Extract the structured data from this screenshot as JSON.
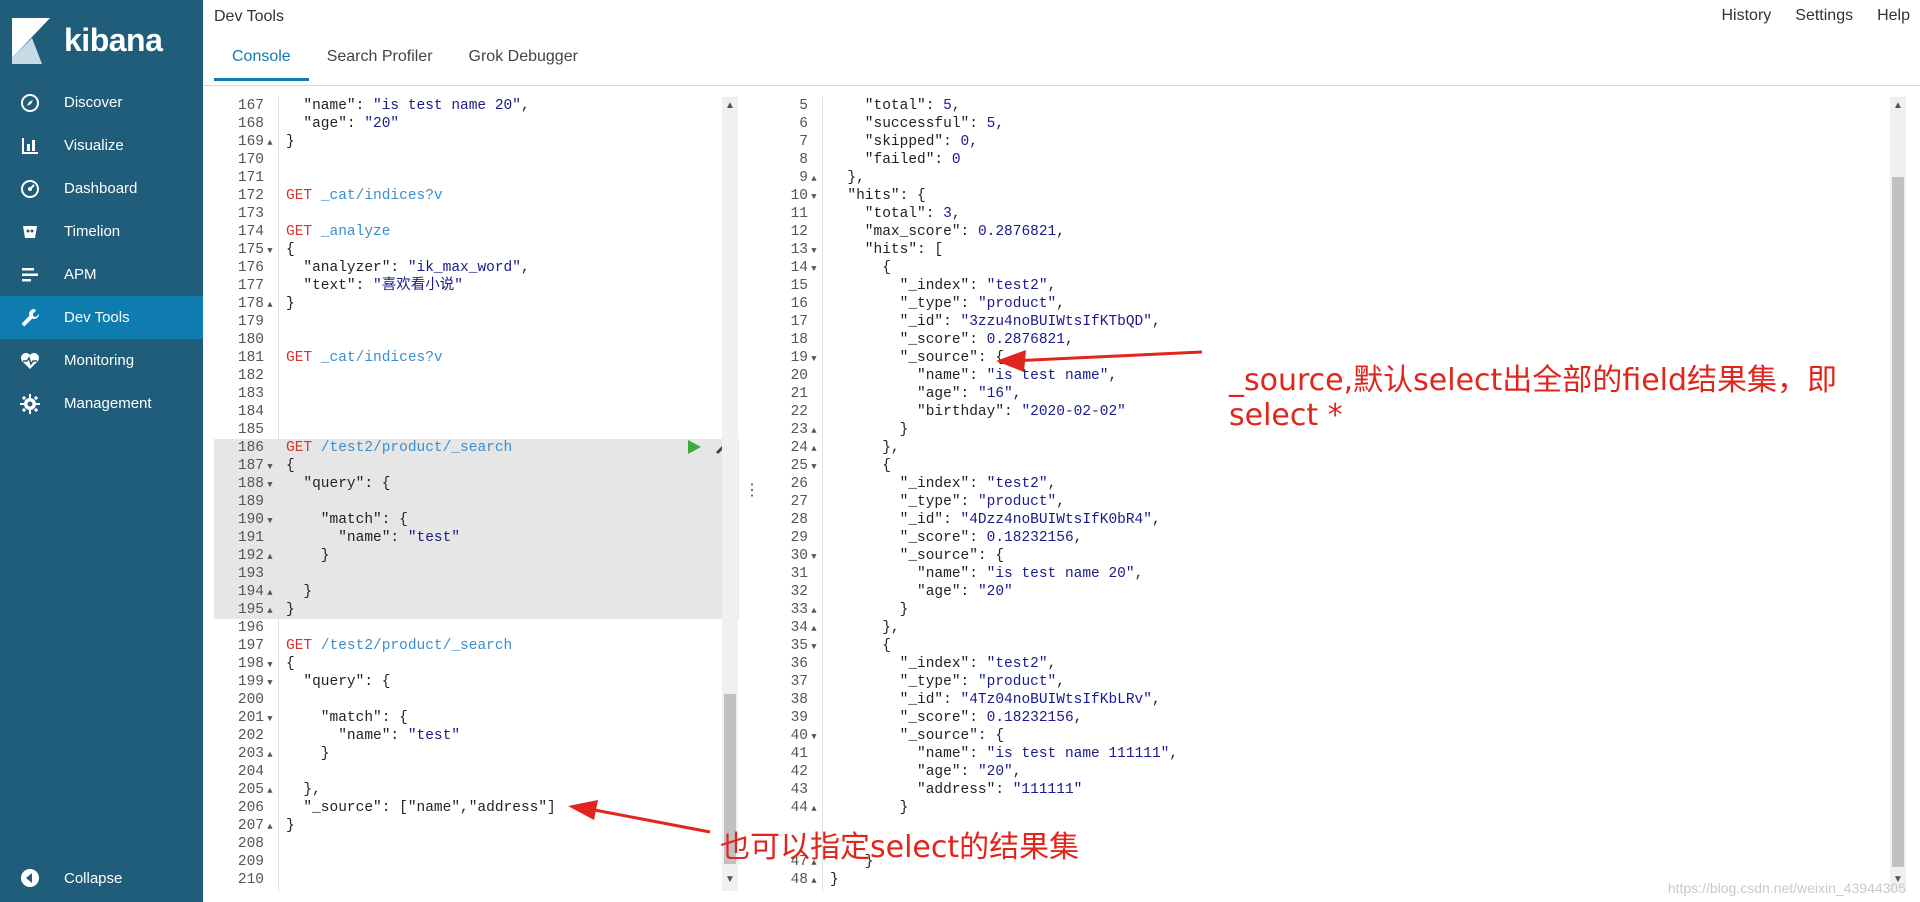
{
  "app": {
    "brand": "kibana",
    "colors": {
      "sidebar": "#1f5d7b",
      "active": "#0f7cb0",
      "annotation": "#e0261c"
    }
  },
  "sidebar": {
    "items": [
      {
        "label": "Discover",
        "icon": "compass-icon",
        "active": false
      },
      {
        "label": "Visualize",
        "icon": "bar-chart-icon",
        "active": false
      },
      {
        "label": "Dashboard",
        "icon": "dashboard-icon",
        "active": false
      },
      {
        "label": "Timelion",
        "icon": "timelion-icon",
        "active": false
      },
      {
        "label": "APM",
        "icon": "apm-icon",
        "active": false
      },
      {
        "label": "Dev Tools",
        "icon": "wrench-icon",
        "active": true
      },
      {
        "label": "Monitoring",
        "icon": "heartbeat-icon",
        "active": false
      },
      {
        "label": "Management",
        "icon": "gear-icon",
        "active": false
      }
    ],
    "collapse_label": "Collapse"
  },
  "header": {
    "title": "Dev Tools",
    "links": [
      "History",
      "Settings",
      "Help"
    ],
    "tabs": [
      {
        "label": "Console",
        "active": true
      },
      {
        "label": "Search Profiler",
        "active": false
      },
      {
        "label": "Grok Debugger",
        "active": false
      }
    ]
  },
  "request_editor": {
    "lines": [
      {
        "n": "167",
        "fold": "",
        "code": "  \"name\": \"is test name 20\","
      },
      {
        "n": "168",
        "fold": "",
        "code": "  \"age\": \"20\""
      },
      {
        "n": "169",
        "fold": "▲",
        "code": "}"
      },
      {
        "n": "170",
        "fold": "",
        "code": ""
      },
      {
        "n": "171",
        "fold": "",
        "code": ""
      },
      {
        "n": "172",
        "fold": "",
        "code": "GET _cat/indices?v"
      },
      {
        "n": "173",
        "fold": "",
        "code": ""
      },
      {
        "n": "174",
        "fold": "",
        "code": "GET _analyze"
      },
      {
        "n": "175",
        "fold": "▼",
        "code": "{"
      },
      {
        "n": "176",
        "fold": "",
        "code": "  \"analyzer\": \"ik_max_word\","
      },
      {
        "n": "177",
        "fold": "",
        "code": "  \"text\": \"喜欢看小说\""
      },
      {
        "n": "178",
        "fold": "▲",
        "code": "}"
      },
      {
        "n": "179",
        "fold": "",
        "code": ""
      },
      {
        "n": "180",
        "fold": "",
        "code": ""
      },
      {
        "n": "181",
        "fold": "",
        "code": "GET _cat/indices?v"
      },
      {
        "n": "182",
        "fold": "",
        "code": ""
      },
      {
        "n": "183",
        "fold": "",
        "code": ""
      },
      {
        "n": "184",
        "fold": "",
        "code": ""
      },
      {
        "n": "185",
        "fold": "",
        "code": ""
      },
      {
        "n": "186",
        "fold": "",
        "code": "GET /test2/product/_search",
        "hl": true
      },
      {
        "n": "187",
        "fold": "▼",
        "code": "{",
        "hl": true
      },
      {
        "n": "188",
        "fold": "▼",
        "code": "  \"query\": {",
        "hl": true
      },
      {
        "n": "189",
        "fold": "",
        "code": "",
        "hl": true
      },
      {
        "n": "190",
        "fold": "▼",
        "code": "    \"match\": {",
        "hl": true
      },
      {
        "n": "191",
        "fold": "",
        "code": "      \"name\": \"test\"",
        "hl": true
      },
      {
        "n": "192",
        "fold": "▲",
        "code": "    }",
        "hl": true
      },
      {
        "n": "193",
        "fold": "",
        "code": "",
        "hl": true
      },
      {
        "n": "194",
        "fold": "▲",
        "code": "  }",
        "hl": true
      },
      {
        "n": "195",
        "fold": "▲",
        "code": "}",
        "hl": true
      },
      {
        "n": "196",
        "fold": "",
        "code": ""
      },
      {
        "n": "197",
        "fold": "",
        "code": "GET /test2/product/_search"
      },
      {
        "n": "198",
        "fold": "▼",
        "code": "{"
      },
      {
        "n": "199",
        "fold": "▼",
        "code": "  \"query\": {"
      },
      {
        "n": "200",
        "fold": "",
        "code": ""
      },
      {
        "n": "201",
        "fold": "▼",
        "code": "    \"match\": {"
      },
      {
        "n": "202",
        "fold": "",
        "code": "      \"name\": \"test\""
      },
      {
        "n": "203",
        "fold": "▲",
        "code": "    }"
      },
      {
        "n": "204",
        "fold": "",
        "code": ""
      },
      {
        "n": "205",
        "fold": "▲",
        "code": "  },"
      },
      {
        "n": "206",
        "fold": "",
        "code": "  \"_source\": [\"name\",\"address\"]"
      },
      {
        "n": "207",
        "fold": "▲",
        "code": "}"
      },
      {
        "n": "208",
        "fold": "",
        "code": ""
      },
      {
        "n": "209",
        "fold": "",
        "code": ""
      },
      {
        "n": "210",
        "fold": "",
        "code": ""
      }
    ]
  },
  "response_viewer": {
    "lines": [
      {
        "n": "5",
        "fold": "",
        "code": "    \"total\": 5,"
      },
      {
        "n": "6",
        "fold": "",
        "code": "    \"successful\": 5,"
      },
      {
        "n": "7",
        "fold": "",
        "code": "    \"skipped\": 0,"
      },
      {
        "n": "8",
        "fold": "",
        "code": "    \"failed\": 0"
      },
      {
        "n": "9",
        "fold": "▲",
        "code": "  },"
      },
      {
        "n": "10",
        "fold": "▼",
        "code": "  \"hits\": {"
      },
      {
        "n": "11",
        "fold": "",
        "code": "    \"total\": 3,"
      },
      {
        "n": "12",
        "fold": "",
        "code": "    \"max_score\": 0.2876821,"
      },
      {
        "n": "13",
        "fold": "▼",
        "code": "    \"hits\": ["
      },
      {
        "n": "14",
        "fold": "▼",
        "code": "      {"
      },
      {
        "n": "15",
        "fold": "",
        "code": "        \"_index\": \"test2\","
      },
      {
        "n": "16",
        "fold": "",
        "code": "        \"_type\": \"product\","
      },
      {
        "n": "17",
        "fold": "",
        "code": "        \"_id\": \"3zzu4noBUIWtsIfKTbQD\","
      },
      {
        "n": "18",
        "fold": "",
        "code": "        \"_score\": 0.2876821,"
      },
      {
        "n": "19",
        "fold": "▼",
        "code": "        \"_source\": {"
      },
      {
        "n": "20",
        "fold": "",
        "code": "          \"name\": \"is test name\","
      },
      {
        "n": "21",
        "fold": "",
        "code": "          \"age\": \"16\","
      },
      {
        "n": "22",
        "fold": "",
        "code": "          \"birthday\": \"2020-02-02\""
      },
      {
        "n": "23",
        "fold": "▲",
        "code": "        }"
      },
      {
        "n": "24",
        "fold": "▲",
        "code": "      },"
      },
      {
        "n": "25",
        "fold": "▼",
        "code": "      {"
      },
      {
        "n": "26",
        "fold": "",
        "code": "        \"_index\": \"test2\","
      },
      {
        "n": "27",
        "fold": "",
        "code": "        \"_type\": \"product\","
      },
      {
        "n": "28",
        "fold": "",
        "code": "        \"_id\": \"4Dzz4noBUIWtsIfK0bR4\","
      },
      {
        "n": "29",
        "fold": "",
        "code": "        \"_score\": 0.18232156,"
      },
      {
        "n": "30",
        "fold": "▼",
        "code": "        \"_source\": {"
      },
      {
        "n": "31",
        "fold": "",
        "code": "          \"name\": \"is test name 20\","
      },
      {
        "n": "32",
        "fold": "",
        "code": "          \"age\": \"20\""
      },
      {
        "n": "33",
        "fold": "▲",
        "code": "        }"
      },
      {
        "n": "34",
        "fold": "▲",
        "code": "      },"
      },
      {
        "n": "35",
        "fold": "▼",
        "code": "      {"
      },
      {
        "n": "36",
        "fold": "",
        "code": "        \"_index\": \"test2\","
      },
      {
        "n": "37",
        "fold": "",
        "code": "        \"_type\": \"product\","
      },
      {
        "n": "38",
        "fold": "",
        "code": "        \"_id\": \"4Tz04noBUIWtsIfKbLRv\","
      },
      {
        "n": "39",
        "fold": "",
        "code": "        \"_score\": 0.18232156,"
      },
      {
        "n": "40",
        "fold": "▼",
        "code": "        \"_source\": {"
      },
      {
        "n": "41",
        "fold": "",
        "code": "          \"name\": \"is test name 111111\","
      },
      {
        "n": "42",
        "fold": "",
        "code": "          \"age\": \"20\","
      },
      {
        "n": "43",
        "fold": "",
        "code": "          \"address\": \"111111\""
      },
      {
        "n": "44",
        "fold": "▲",
        "code": "        }"
      },
      {
        "n": "",
        "fold": "",
        "code": ""
      },
      {
        "n": "",
        "fold": "",
        "code": ""
      },
      {
        "n": "47",
        "fold": "▲",
        "code": "    }"
      },
      {
        "n": "48",
        "fold": "▲",
        "code": "}"
      }
    ]
  },
  "annotations": {
    "right_note_line1": "_source,默认select出全部的field结果集，即",
    "right_note_line2": "select *",
    "left_note": "也可以指定select的结果集"
  },
  "watermark": "https://blog.csdn.net/weixin_43944305"
}
